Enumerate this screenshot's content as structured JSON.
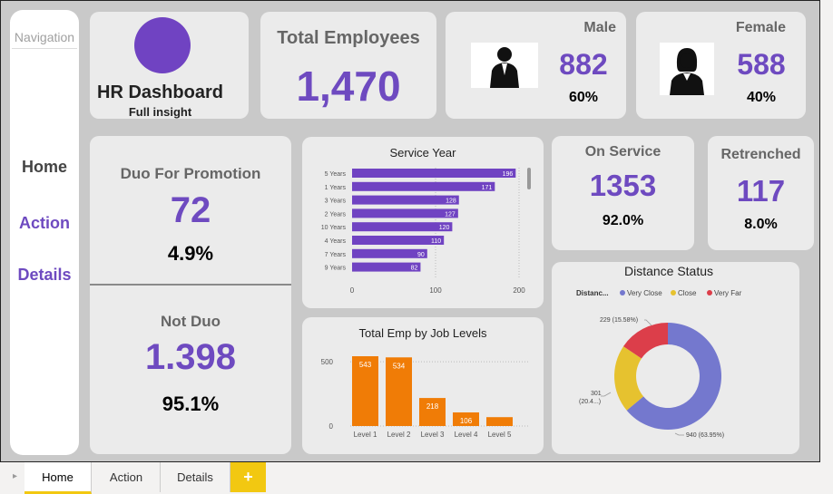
{
  "nav": {
    "title": "Navigation",
    "items": [
      "Home",
      "Action",
      "Details"
    ]
  },
  "header": {
    "title": "HR Dashboard",
    "subtitle": "Full insight"
  },
  "total": {
    "label": "Total Employees",
    "value": "1,470"
  },
  "male": {
    "label": "Male",
    "value": "882",
    "pct": "60%"
  },
  "female": {
    "label": "Female",
    "value": "588",
    "pct": "40%"
  },
  "promotion": {
    "label": "Duo For Promotion",
    "value": "72",
    "pct": "4.9%"
  },
  "not_duo": {
    "label": "Not Duo",
    "value": "1.398",
    "pct": "95.1%"
  },
  "on_service": {
    "label": "On Service",
    "value": "1353",
    "pct": "92.0%"
  },
  "retrenched": {
    "label": "Retrenched",
    "value": "117",
    "pct": "8.0%"
  },
  "colors": {
    "accent": "#6e4ac0",
    "bar": "#7043c2",
    "orange": "#f07c06",
    "very_close": "#7478ce",
    "close": "#e6c22f",
    "very_far": "#dc3e4a"
  },
  "chart_data": [
    {
      "type": "bar",
      "title": "Service Year",
      "orientation": "horizontal",
      "categories": [
        "5 Years",
        "1 Years",
        "3 Years",
        "2 Years",
        "10 Years",
        "4 Years",
        "7 Years",
        "9 Years"
      ],
      "values": [
        196,
        171,
        128,
        127,
        120,
        110,
        90,
        82
      ],
      "xticks": [
        "0",
        "100",
        "200"
      ],
      "xlim": [
        0,
        200
      ]
    },
    {
      "type": "bar",
      "title": "Total Emp by Job Levels",
      "categories": [
        "Level 1",
        "Level 2",
        "Level 3",
        "Level 4",
        "Level 5"
      ],
      "values": [
        543,
        534,
        218,
        106,
        69
      ],
      "data_labels": [
        "543",
        "534",
        "218",
        "106",
        ""
      ],
      "yticks": [
        "500",
        "0"
      ],
      "ylim": [
        0,
        543
      ]
    },
    {
      "type": "pie",
      "title": "Distance Status",
      "legend_title": "Distanc...",
      "labels": [
        "Very Close",
        "Close",
        "Very Far"
      ],
      "values": [
        940,
        301,
        229
      ],
      "data_labels": [
        "940 (63.95%)",
        "301 (20.4...)",
        "229 (15.58%)"
      ]
    }
  ],
  "tabs": {
    "items": [
      "Home",
      "Action",
      "Details"
    ],
    "add": "+"
  }
}
